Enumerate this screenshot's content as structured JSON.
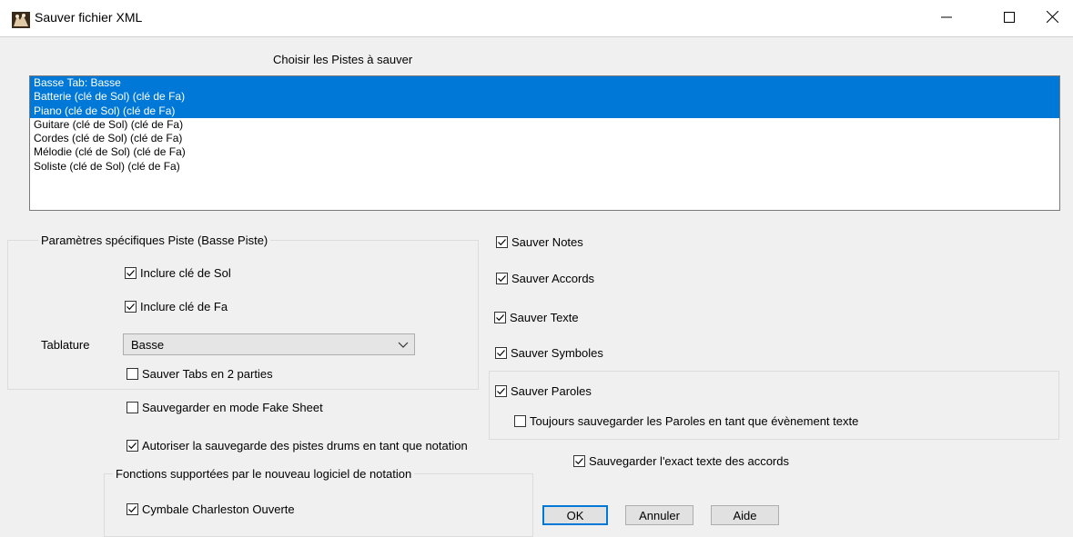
{
  "window": {
    "title": "Sauver fichier XML",
    "icons": {
      "app": "band-in-a-box-icon",
      "minimize": "minimize-icon",
      "maximize": "maximize-icon",
      "close": "close-icon"
    }
  },
  "tracks": {
    "heading": "Choisir les Pistes à sauver",
    "items": [
      {
        "label": "Basse Tab: Basse",
        "selected": true
      },
      {
        "label": "Batterie (clé de Sol) (clé de Fa)",
        "selected": true
      },
      {
        "label": "Piano (clé de Sol) (clé de Fa)",
        "selected": true
      },
      {
        "label": "Guitare (clé de Sol) (clé de Fa)",
        "selected": false
      },
      {
        "label": "Cordes (clé de Sol) (clé de Fa)",
        "selected": false
      },
      {
        "label": "Mélodie (clé de Sol) (clé de Fa)",
        "selected": false
      },
      {
        "label": "Soliste (clé de Sol) (clé de Fa)",
        "selected": false
      }
    ]
  },
  "track_settings": {
    "legend": "Paramètres spécifiques Piste (Basse Piste)",
    "include_treble": {
      "label": "Inclure clé de Sol",
      "checked": true
    },
    "include_bass": {
      "label": "Inclure clé de Fa",
      "checked": true
    },
    "tablature_label": "Tablature",
    "tablature_value": "Basse",
    "save_tabs_two_parts": {
      "label": "Sauver Tabs en 2 parties",
      "checked": false
    }
  },
  "fake_sheet": {
    "label": "Sauvegarder en mode Fake Sheet",
    "checked": false
  },
  "drums_as_notation": {
    "label": "Autoriser la sauvegarde des pistes drums en tant que notation",
    "checked": true
  },
  "new_notation": {
    "legend": "Fonctions supportées par le nouveau logiciel de notation",
    "hihat_open": {
      "label": "Cymbale Charleston Ouverte",
      "checked": true
    }
  },
  "save_options": {
    "notes": {
      "label": "Sauver Notes",
      "checked": true
    },
    "chords": {
      "label": "Sauver Accords",
      "checked": true
    },
    "text": {
      "label": "Sauver Texte",
      "checked": true
    },
    "symbols": {
      "label": "Sauver Symboles",
      "checked": true
    },
    "lyrics": {
      "label": "Sauver Paroles",
      "checked": true
    },
    "lyrics_as_text": {
      "label": "Toujours sauvegarder les Paroles en tant que évènement texte",
      "checked": false
    },
    "exact_chord_text": {
      "label": "Sauvegarder l'exact texte des accords",
      "checked": true
    }
  },
  "buttons": {
    "ok": "OK",
    "cancel": "Annuler",
    "help": "Aide"
  },
  "colors": {
    "selection": "#0078d7",
    "dialog_bg": "#f0f0f0",
    "default_button_border": "#0078d7"
  }
}
